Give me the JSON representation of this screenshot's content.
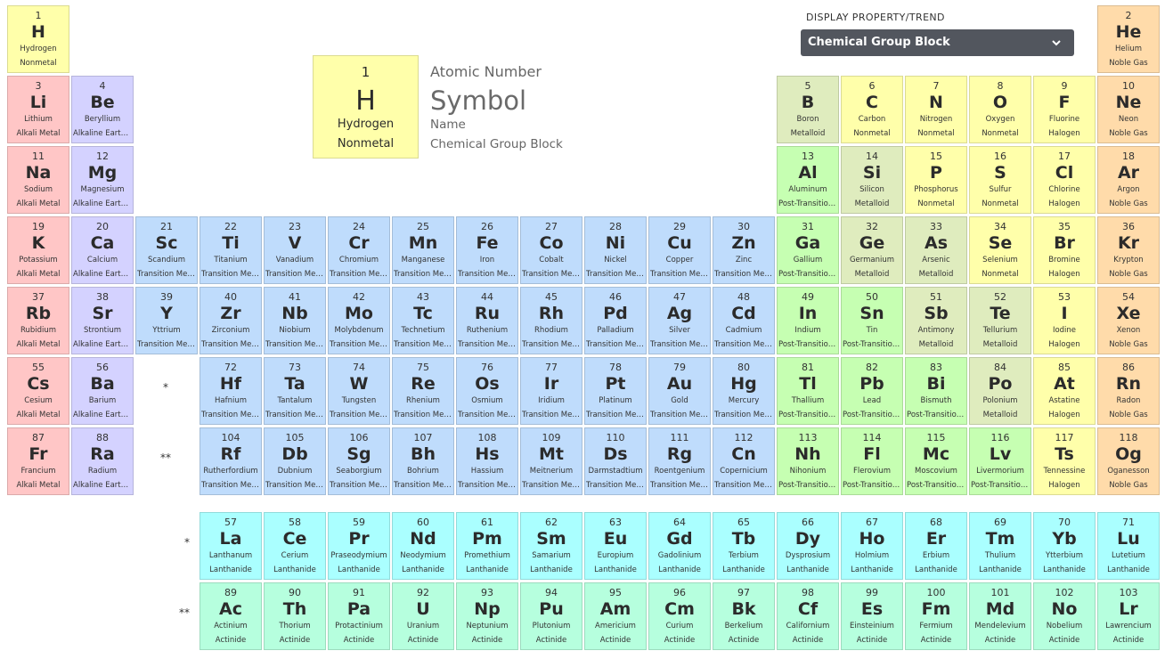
{
  "display_property": {
    "label": "DISPLAY PROPERTY/TREND",
    "selected": "Chemical Group Block",
    "dropdown_icon": "chevron-down-icon"
  },
  "legend": {
    "atomic_number_label": "Atomic Number",
    "symbol_label": "Symbol",
    "name_label": "Name",
    "group_label": "Chemical Group Block",
    "example": {
      "number": "1",
      "symbol": "H",
      "name": "Hydrogen",
      "group": "Nonmetal"
    }
  },
  "markers": {
    "lanthanide": "*",
    "actinide": "**"
  },
  "group_colors": {
    "Nonmetal": "#ffffaa",
    "Noble Gas": "#ffdbaa",
    "Alkali Metal": "#ffc6c6",
    "Alkaline Earth Metal": "#d4d2ff",
    "Transition Metal": "#bfdcfc",
    "Metalloid": "#dfecbe",
    "Halogen": "#ffffaa",
    "Post-Transition Metal": "#c6ffb2",
    "Lanthanide": "#aaffff",
    "Actinide": "#b6ffde"
  },
  "elements": [
    {
      "number": "1",
      "symbol": "H",
      "name": "Hydrogen",
      "group": "Nonmetal",
      "row": 1,
      "col": 1
    },
    {
      "number": "2",
      "symbol": "He",
      "name": "Helium",
      "group": "Noble Gas",
      "row": 1,
      "col": 18
    },
    {
      "number": "3",
      "symbol": "Li",
      "name": "Lithium",
      "group": "Alkali Metal",
      "row": 2,
      "col": 1
    },
    {
      "number": "4",
      "symbol": "Be",
      "name": "Beryllium",
      "group": "Alkaline Earth Metal",
      "row": 2,
      "col": 2
    },
    {
      "number": "5",
      "symbol": "B",
      "name": "Boron",
      "group": "Metalloid",
      "row": 2,
      "col": 13
    },
    {
      "number": "6",
      "symbol": "C",
      "name": "Carbon",
      "group": "Nonmetal",
      "row": 2,
      "col": 14
    },
    {
      "number": "7",
      "symbol": "N",
      "name": "Nitrogen",
      "group": "Nonmetal",
      "row": 2,
      "col": 15
    },
    {
      "number": "8",
      "symbol": "O",
      "name": "Oxygen",
      "group": "Nonmetal",
      "row": 2,
      "col": 16
    },
    {
      "number": "9",
      "symbol": "F",
      "name": "Fluorine",
      "group": "Halogen",
      "row": 2,
      "col": 17
    },
    {
      "number": "10",
      "symbol": "Ne",
      "name": "Neon",
      "group": "Noble Gas",
      "row": 2,
      "col": 18
    },
    {
      "number": "11",
      "symbol": "Na",
      "name": "Sodium",
      "group": "Alkali Metal",
      "row": 3,
      "col": 1
    },
    {
      "number": "12",
      "symbol": "Mg",
      "name": "Magnesium",
      "group": "Alkaline Earth Metal",
      "row": 3,
      "col": 2
    },
    {
      "number": "13",
      "symbol": "Al",
      "name": "Aluminum",
      "group": "Post-Transition Metal",
      "row": 3,
      "col": 13
    },
    {
      "number": "14",
      "symbol": "Si",
      "name": "Silicon",
      "group": "Metalloid",
      "row": 3,
      "col": 14
    },
    {
      "number": "15",
      "symbol": "P",
      "name": "Phosphorus",
      "group": "Nonmetal",
      "row": 3,
      "col": 15
    },
    {
      "number": "16",
      "symbol": "S",
      "name": "Sulfur",
      "group": "Nonmetal",
      "row": 3,
      "col": 16
    },
    {
      "number": "17",
      "symbol": "Cl",
      "name": "Chlorine",
      "group": "Halogen",
      "row": 3,
      "col": 17
    },
    {
      "number": "18",
      "symbol": "Ar",
      "name": "Argon",
      "group": "Noble Gas",
      "row": 3,
      "col": 18
    },
    {
      "number": "19",
      "symbol": "K",
      "name": "Potassium",
      "group": "Alkali Metal",
      "row": 4,
      "col": 1
    },
    {
      "number": "20",
      "symbol": "Ca",
      "name": "Calcium",
      "group": "Alkaline Earth Metal",
      "row": 4,
      "col": 2
    },
    {
      "number": "21",
      "symbol": "Sc",
      "name": "Scandium",
      "group": "Transition Metal",
      "row": 4,
      "col": 3
    },
    {
      "number": "22",
      "symbol": "Ti",
      "name": "Titanium",
      "group": "Transition Metal",
      "row": 4,
      "col": 4
    },
    {
      "number": "23",
      "symbol": "V",
      "name": "Vanadium",
      "group": "Transition Metal",
      "row": 4,
      "col": 5
    },
    {
      "number": "24",
      "symbol": "Cr",
      "name": "Chromium",
      "group": "Transition Metal",
      "row": 4,
      "col": 6
    },
    {
      "number": "25",
      "symbol": "Mn",
      "name": "Manganese",
      "group": "Transition Metal",
      "row": 4,
      "col": 7
    },
    {
      "number": "26",
      "symbol": "Fe",
      "name": "Iron",
      "group": "Transition Metal",
      "row": 4,
      "col": 8
    },
    {
      "number": "27",
      "symbol": "Co",
      "name": "Cobalt",
      "group": "Transition Metal",
      "row": 4,
      "col": 9
    },
    {
      "number": "28",
      "symbol": "Ni",
      "name": "Nickel",
      "group": "Transition Metal",
      "row": 4,
      "col": 10
    },
    {
      "number": "29",
      "symbol": "Cu",
      "name": "Copper",
      "group": "Transition Metal",
      "row": 4,
      "col": 11
    },
    {
      "number": "30",
      "symbol": "Zn",
      "name": "Zinc",
      "group": "Transition Metal",
      "row": 4,
      "col": 12
    },
    {
      "number": "31",
      "symbol": "Ga",
      "name": "Gallium",
      "group": "Post-Transition Metal",
      "row": 4,
      "col": 13
    },
    {
      "number": "32",
      "symbol": "Ge",
      "name": "Germanium",
      "group": "Metalloid",
      "row": 4,
      "col": 14
    },
    {
      "number": "33",
      "symbol": "As",
      "name": "Arsenic",
      "group": "Metalloid",
      "row": 4,
      "col": 15
    },
    {
      "number": "34",
      "symbol": "Se",
      "name": "Selenium",
      "group": "Nonmetal",
      "row": 4,
      "col": 16
    },
    {
      "number": "35",
      "symbol": "Br",
      "name": "Bromine",
      "group": "Halogen",
      "row": 4,
      "col": 17
    },
    {
      "number": "36",
      "symbol": "Kr",
      "name": "Krypton",
      "group": "Noble Gas",
      "row": 4,
      "col": 18
    },
    {
      "number": "37",
      "symbol": "Rb",
      "name": "Rubidium",
      "group": "Alkali Metal",
      "row": 5,
      "col": 1
    },
    {
      "number": "38",
      "symbol": "Sr",
      "name": "Strontium",
      "group": "Alkaline Earth Metal",
      "row": 5,
      "col": 2
    },
    {
      "number": "39",
      "symbol": "Y",
      "name": "Yttrium",
      "group": "Transition Metal",
      "row": 5,
      "col": 3
    },
    {
      "number": "40",
      "symbol": "Zr",
      "name": "Zirconium",
      "group": "Transition Metal",
      "row": 5,
      "col": 4
    },
    {
      "number": "41",
      "symbol": "Nb",
      "name": "Niobium",
      "group": "Transition Metal",
      "row": 5,
      "col": 5
    },
    {
      "number": "42",
      "symbol": "Mo",
      "name": "Molybdenum",
      "group": "Transition Metal",
      "row": 5,
      "col": 6
    },
    {
      "number": "43",
      "symbol": "Tc",
      "name": "Technetium",
      "group": "Transition Metal",
      "row": 5,
      "col": 7
    },
    {
      "number": "44",
      "symbol": "Ru",
      "name": "Ruthenium",
      "group": "Transition Metal",
      "row": 5,
      "col": 8
    },
    {
      "number": "45",
      "symbol": "Rh",
      "name": "Rhodium",
      "group": "Transition Metal",
      "row": 5,
      "col": 9
    },
    {
      "number": "46",
      "symbol": "Pd",
      "name": "Palladium",
      "group": "Transition Metal",
      "row": 5,
      "col": 10
    },
    {
      "number": "47",
      "symbol": "Ag",
      "name": "Silver",
      "group": "Transition Metal",
      "row": 5,
      "col": 11
    },
    {
      "number": "48",
      "symbol": "Cd",
      "name": "Cadmium",
      "group": "Transition Metal",
      "row": 5,
      "col": 12
    },
    {
      "number": "49",
      "symbol": "In",
      "name": "Indium",
      "group": "Post-Transition Metal",
      "row": 5,
      "col": 13
    },
    {
      "number": "50",
      "symbol": "Sn",
      "name": "Tin",
      "group": "Post-Transition Metal",
      "row": 5,
      "col": 14
    },
    {
      "number": "51",
      "symbol": "Sb",
      "name": "Antimony",
      "group": "Metalloid",
      "row": 5,
      "col": 15
    },
    {
      "number": "52",
      "symbol": "Te",
      "name": "Tellurium",
      "group": "Metalloid",
      "row": 5,
      "col": 16
    },
    {
      "number": "53",
      "symbol": "I",
      "name": "Iodine",
      "group": "Halogen",
      "row": 5,
      "col": 17
    },
    {
      "number": "54",
      "symbol": "Xe",
      "name": "Xenon",
      "group": "Noble Gas",
      "row": 5,
      "col": 18
    },
    {
      "number": "55",
      "symbol": "Cs",
      "name": "Cesium",
      "group": "Alkali Metal",
      "row": 6,
      "col": 1
    },
    {
      "number": "56",
      "symbol": "Ba",
      "name": "Barium",
      "group": "Alkaline Earth Metal",
      "row": 6,
      "col": 2
    },
    {
      "number": "72",
      "symbol": "Hf",
      "name": "Hafnium",
      "group": "Transition Metal",
      "row": 6,
      "col": 4
    },
    {
      "number": "73",
      "symbol": "Ta",
      "name": "Tantalum",
      "group": "Transition Metal",
      "row": 6,
      "col": 5
    },
    {
      "number": "74",
      "symbol": "W",
      "name": "Tungsten",
      "group": "Transition Metal",
      "row": 6,
      "col": 6
    },
    {
      "number": "75",
      "symbol": "Re",
      "name": "Rhenium",
      "group": "Transition Metal",
      "row": 6,
      "col": 7
    },
    {
      "number": "76",
      "symbol": "Os",
      "name": "Osmium",
      "group": "Transition Metal",
      "row": 6,
      "col": 8
    },
    {
      "number": "77",
      "symbol": "Ir",
      "name": "Iridium",
      "group": "Transition Metal",
      "row": 6,
      "col": 9
    },
    {
      "number": "78",
      "symbol": "Pt",
      "name": "Platinum",
      "group": "Transition Metal",
      "row": 6,
      "col": 10
    },
    {
      "number": "79",
      "symbol": "Au",
      "name": "Gold",
      "group": "Transition Metal",
      "row": 6,
      "col": 11
    },
    {
      "number": "80",
      "symbol": "Hg",
      "name": "Mercury",
      "group": "Transition Metal",
      "row": 6,
      "col": 12
    },
    {
      "number": "81",
      "symbol": "Tl",
      "name": "Thallium",
      "group": "Post-Transition Metal",
      "row": 6,
      "col": 13
    },
    {
      "number": "82",
      "symbol": "Pb",
      "name": "Lead",
      "group": "Post-Transition Metal",
      "row": 6,
      "col": 14
    },
    {
      "number": "83",
      "symbol": "Bi",
      "name": "Bismuth",
      "group": "Post-Transition Metal",
      "row": 6,
      "col": 15
    },
    {
      "number": "84",
      "symbol": "Po",
      "name": "Polonium",
      "group": "Metalloid",
      "row": 6,
      "col": 16
    },
    {
      "number": "85",
      "symbol": "At",
      "name": "Astatine",
      "group": "Halogen",
      "row": 6,
      "col": 17
    },
    {
      "number": "86",
      "symbol": "Rn",
      "name": "Radon",
      "group": "Noble Gas",
      "row": 6,
      "col": 18
    },
    {
      "number": "87",
      "symbol": "Fr",
      "name": "Francium",
      "group": "Alkali Metal",
      "row": 7,
      "col": 1
    },
    {
      "number": "88",
      "symbol": "Ra",
      "name": "Radium",
      "group": "Alkaline Earth Metal",
      "row": 7,
      "col": 2
    },
    {
      "number": "104",
      "symbol": "Rf",
      "name": "Rutherfordium",
      "group": "Transition Metal",
      "row": 7,
      "col": 4
    },
    {
      "number": "105",
      "symbol": "Db",
      "name": "Dubnium",
      "group": "Transition Metal",
      "row": 7,
      "col": 5
    },
    {
      "number": "106",
      "symbol": "Sg",
      "name": "Seaborgium",
      "group": "Transition Metal",
      "row": 7,
      "col": 6
    },
    {
      "number": "107",
      "symbol": "Bh",
      "name": "Bohrium",
      "group": "Transition Metal",
      "row": 7,
      "col": 7
    },
    {
      "number": "108",
      "symbol": "Hs",
      "name": "Hassium",
      "group": "Transition Metal",
      "row": 7,
      "col": 8
    },
    {
      "number": "109",
      "symbol": "Mt",
      "name": "Meitnerium",
      "group": "Transition Metal",
      "row": 7,
      "col": 9
    },
    {
      "number": "110",
      "symbol": "Ds",
      "name": "Darmstadtium",
      "group": "Transition Metal",
      "row": 7,
      "col": 10
    },
    {
      "number": "111",
      "symbol": "Rg",
      "name": "Roentgenium",
      "group": "Transition Metal",
      "row": 7,
      "col": 11
    },
    {
      "number": "112",
      "symbol": "Cn",
      "name": "Copernicium",
      "group": "Transition Metal",
      "row": 7,
      "col": 12
    },
    {
      "number": "113",
      "symbol": "Nh",
      "name": "Nihonium",
      "group": "Post-Transition Metal",
      "row": 7,
      "col": 13
    },
    {
      "number": "114",
      "symbol": "Fl",
      "name": "Flerovium",
      "group": "Post-Transition Metal",
      "row": 7,
      "col": 14
    },
    {
      "number": "115",
      "symbol": "Mc",
      "name": "Moscovium",
      "group": "Post-Transition Metal",
      "row": 7,
      "col": 15
    },
    {
      "number": "116",
      "symbol": "Lv",
      "name": "Livermorium",
      "group": "Post-Transition Metal",
      "row": 7,
      "col": 16
    },
    {
      "number": "117",
      "symbol": "Ts",
      "name": "Tennessine",
      "group": "Halogen",
      "row": 7,
      "col": 17
    },
    {
      "number": "118",
      "symbol": "Og",
      "name": "Oganesson",
      "group": "Noble Gas",
      "row": 7,
      "col": 18
    },
    {
      "number": "57",
      "symbol": "La",
      "name": "Lanthanum",
      "group": "Lanthanide",
      "row": 9,
      "col": 4
    },
    {
      "number": "58",
      "symbol": "Ce",
      "name": "Cerium",
      "group": "Lanthanide",
      "row": 9,
      "col": 5
    },
    {
      "number": "59",
      "symbol": "Pr",
      "name": "Praseodymium",
      "group": "Lanthanide",
      "row": 9,
      "col": 6
    },
    {
      "number": "60",
      "symbol": "Nd",
      "name": "Neodymium",
      "group": "Lanthanide",
      "row": 9,
      "col": 7
    },
    {
      "number": "61",
      "symbol": "Pm",
      "name": "Promethium",
      "group": "Lanthanide",
      "row": 9,
      "col": 8
    },
    {
      "number": "62",
      "symbol": "Sm",
      "name": "Samarium",
      "group": "Lanthanide",
      "row": 9,
      "col": 9
    },
    {
      "number": "63",
      "symbol": "Eu",
      "name": "Europium",
      "group": "Lanthanide",
      "row": 9,
      "col": 10
    },
    {
      "number": "64",
      "symbol": "Gd",
      "name": "Gadolinium",
      "group": "Lanthanide",
      "row": 9,
      "col": 11
    },
    {
      "number": "65",
      "symbol": "Tb",
      "name": "Terbium",
      "group": "Lanthanide",
      "row": 9,
      "col": 12
    },
    {
      "number": "66",
      "symbol": "Dy",
      "name": "Dysprosium",
      "group": "Lanthanide",
      "row": 9,
      "col": 13
    },
    {
      "number": "67",
      "symbol": "Ho",
      "name": "Holmium",
      "group": "Lanthanide",
      "row": 9,
      "col": 14
    },
    {
      "number": "68",
      "symbol": "Er",
      "name": "Erbium",
      "group": "Lanthanide",
      "row": 9,
      "col": 15
    },
    {
      "number": "69",
      "symbol": "Tm",
      "name": "Thulium",
      "group": "Lanthanide",
      "row": 9,
      "col": 16
    },
    {
      "number": "70",
      "symbol": "Yb",
      "name": "Ytterbium",
      "group": "Lanthanide",
      "row": 9,
      "col": 17
    },
    {
      "number": "71",
      "symbol": "Lu",
      "name": "Lutetium",
      "group": "Lanthanide",
      "row": 9,
      "col": 18
    },
    {
      "number": "89",
      "symbol": "Ac",
      "name": "Actinium",
      "group": "Actinide",
      "row": 10,
      "col": 4
    },
    {
      "number": "90",
      "symbol": "Th",
      "name": "Thorium",
      "group": "Actinide",
      "row": 10,
      "col": 5
    },
    {
      "number": "91",
      "symbol": "Pa",
      "name": "Protactinium",
      "group": "Actinide",
      "row": 10,
      "col": 6
    },
    {
      "number": "92",
      "symbol": "U",
      "name": "Uranium",
      "group": "Actinide",
      "row": 10,
      "col": 7
    },
    {
      "number": "93",
      "symbol": "Np",
      "name": "Neptunium",
      "group": "Actinide",
      "row": 10,
      "col": 8
    },
    {
      "number": "94",
      "symbol": "Pu",
      "name": "Plutonium",
      "group": "Actinide",
      "row": 10,
      "col": 9
    },
    {
      "number": "95",
      "symbol": "Am",
      "name": "Americium",
      "group": "Actinide",
      "row": 10,
      "col": 10
    },
    {
      "number": "96",
      "symbol": "Cm",
      "name": "Curium",
      "group": "Actinide",
      "row": 10,
      "col": 11
    },
    {
      "number": "97",
      "symbol": "Bk",
      "name": "Berkelium",
      "group": "Actinide",
      "row": 10,
      "col": 12
    },
    {
      "number": "98",
      "symbol": "Cf",
      "name": "Californium",
      "group": "Actinide",
      "row": 10,
      "col": 13
    },
    {
      "number": "99",
      "symbol": "Es",
      "name": "Einsteinium",
      "group": "Actinide",
      "row": 10,
      "col": 14
    },
    {
      "number": "100",
      "symbol": "Fm",
      "name": "Fermium",
      "group": "Actinide",
      "row": 10,
      "col": 15
    },
    {
      "number": "101",
      "symbol": "Md",
      "name": "Mendelevium",
      "group": "Actinide",
      "row": 10,
      "col": 16
    },
    {
      "number": "102",
      "symbol": "No",
      "name": "Nobelium",
      "group": "Actinide",
      "row": 10,
      "col": 17
    },
    {
      "number": "103",
      "symbol": "Lr",
      "name": "Lawrencium",
      "group": "Actinide",
      "row": 10,
      "col": 18
    }
  ]
}
